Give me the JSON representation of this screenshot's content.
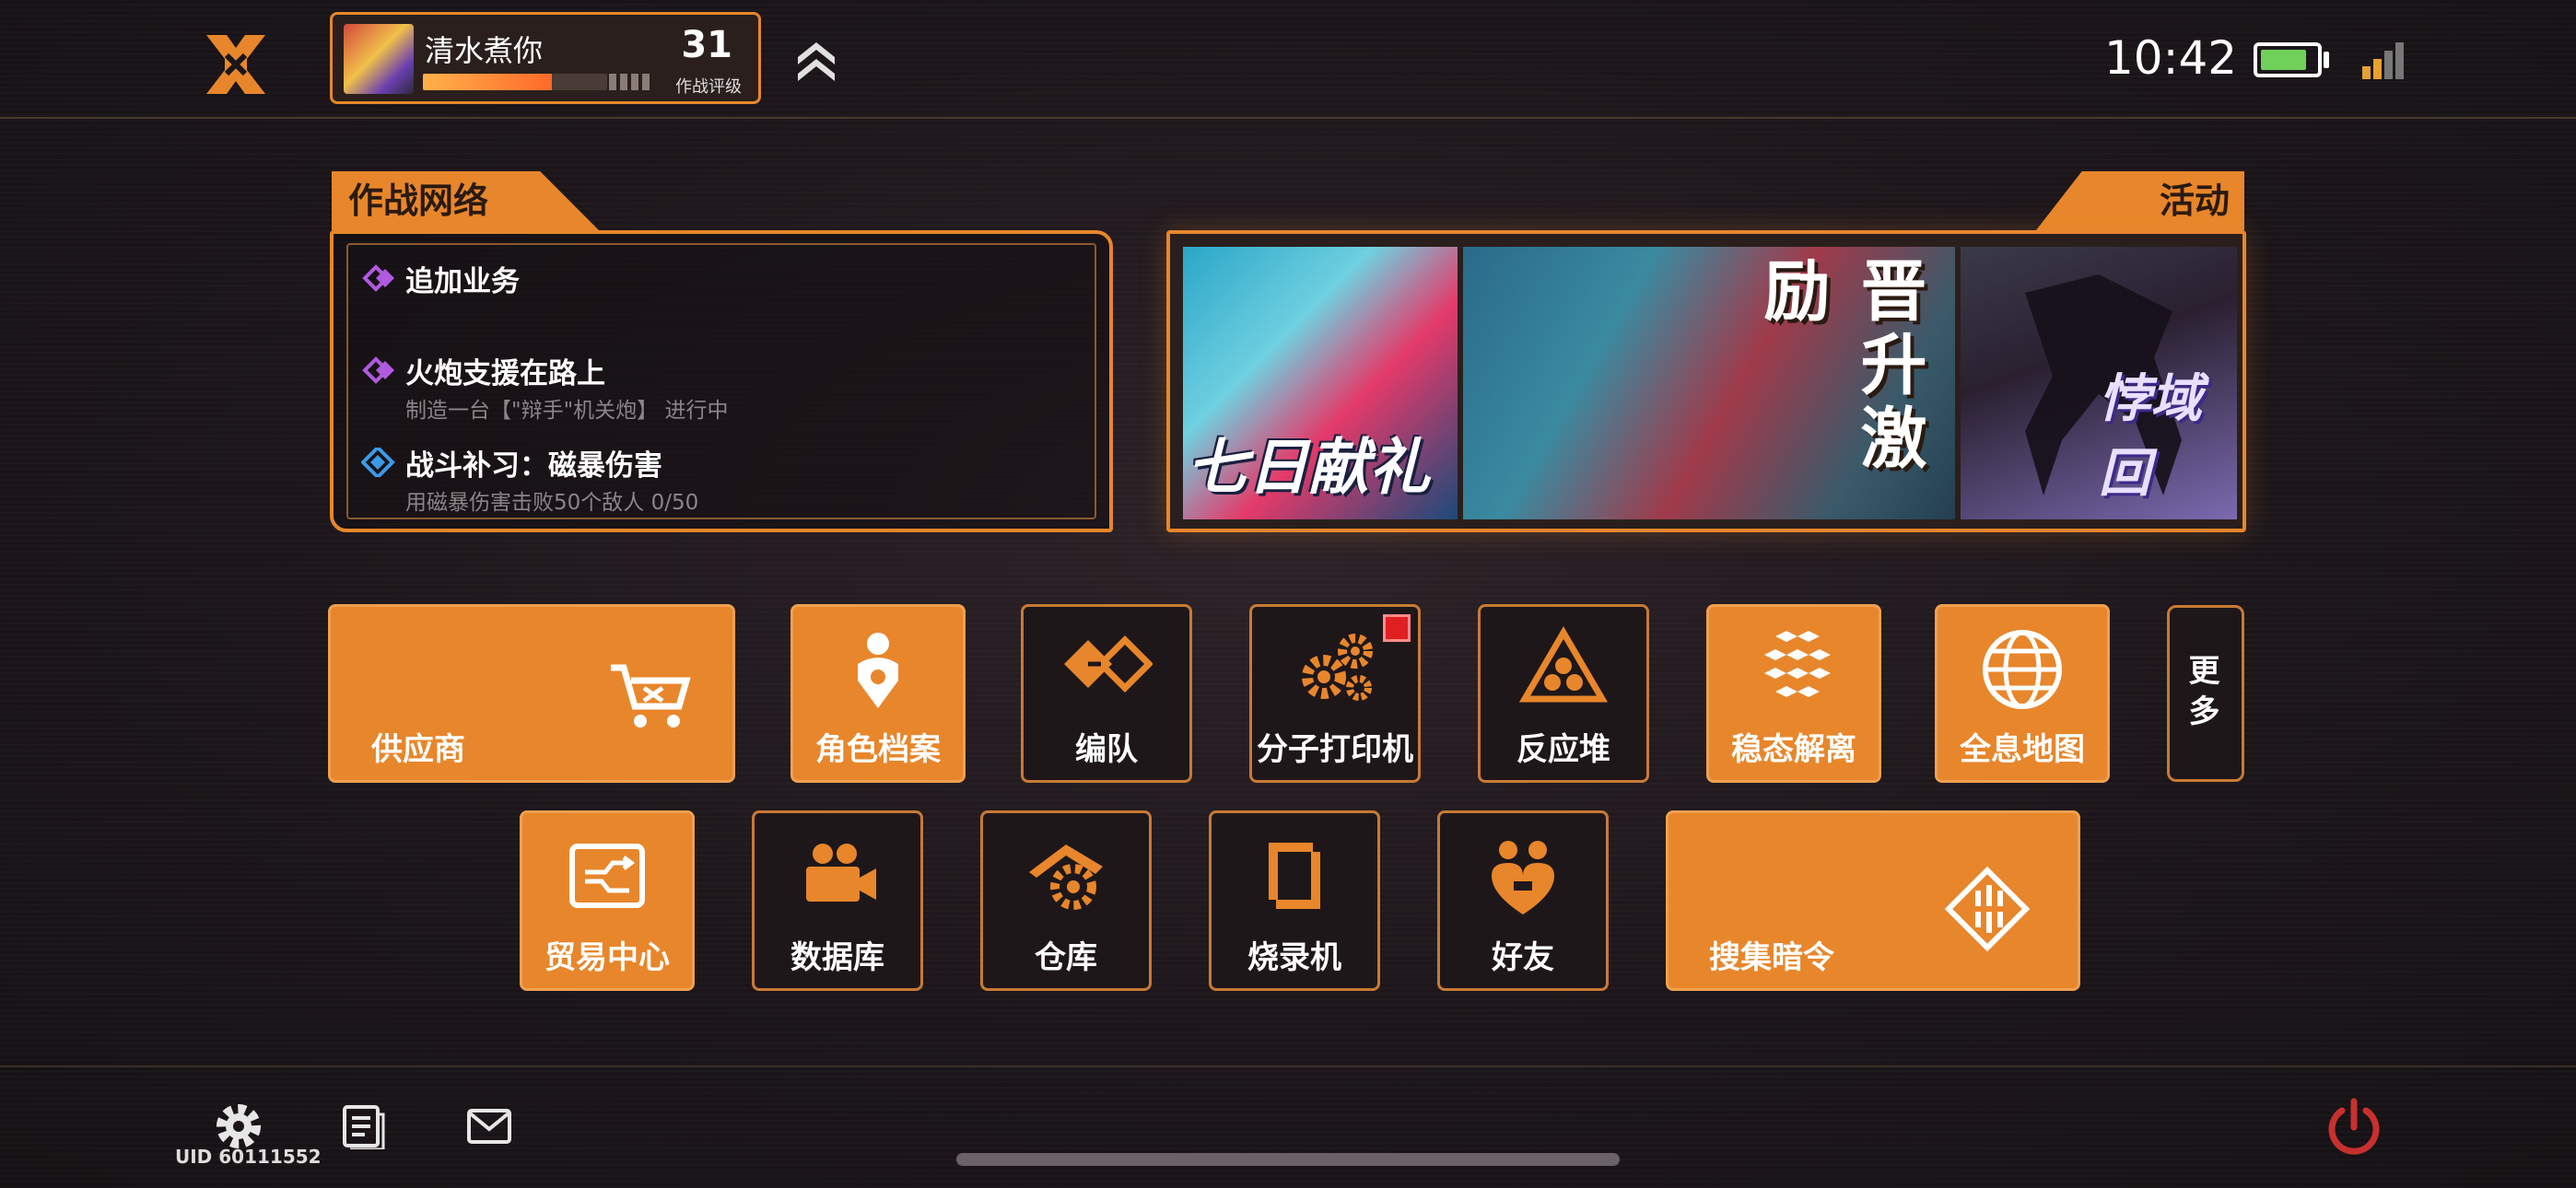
{
  "header": {
    "player_name": "清水煮你",
    "combat_level": "31",
    "combat_level_label": "作战评级",
    "exp_progress": 0.7,
    "time": "10:42",
    "battery_level": 0.85
  },
  "network_panel": {
    "title": "作战网络",
    "tasks": [
      {
        "title": "追加业务",
        "subtitle": "",
        "icon": "purple-diamond-icon"
      },
      {
        "title": "火炮支援在路上",
        "subtitle": "制造一台【\"辩手\"机关炮】 进行中",
        "icon": "purple-diamond-icon"
      },
      {
        "title": "战斗补习：磁暴伤害",
        "subtitle": "用磁暴伤害击败50个敌人 0/50",
        "icon": "blue-diamond-icon"
      }
    ]
  },
  "activity_panel": {
    "title": "活动",
    "banners": [
      {
        "text": "七日献礼"
      },
      {
        "text": "晋升激励"
      },
      {
        "text": "悖域回"
      }
    ]
  },
  "menu": {
    "supplier": "供应商",
    "character_archive": "角色档案",
    "formation": "编队",
    "molecular_printer": "分子打印机",
    "reactor": "反应堆",
    "steady_dissociation": "稳态解离",
    "holo_map": "全息地图",
    "more": "更多",
    "trade_center": "贸易中心",
    "database": "数据库",
    "warehouse": "仓库",
    "burner": "烧录机",
    "friends": "好友",
    "collect_codes": "搜集暗令"
  },
  "footer": {
    "uid": "UID 60111552"
  },
  "colors": {
    "accent": "#e8862b",
    "background": "#1b1519",
    "badge": "#e02020",
    "battery": "#6fd05a"
  }
}
